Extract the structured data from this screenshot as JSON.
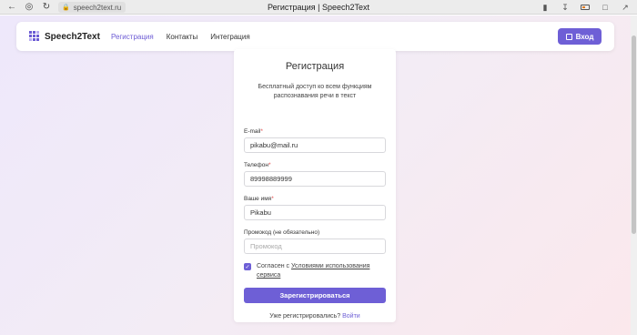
{
  "browser": {
    "address": "speech2text.ru",
    "tab_title": "Регистрация | Speech2Text"
  },
  "header": {
    "logo_text": "Speech2Text",
    "nav": [
      {
        "label": "Регистрация",
        "active": true
      },
      {
        "label": "Контакты",
        "active": false
      },
      {
        "label": "Интеграция",
        "active": false
      }
    ],
    "login_label": "Вход"
  },
  "form": {
    "title": "Регистрация",
    "subtitle": "Бесплатный доступ ко всем функциям распознавания речи в текст",
    "fields": [
      {
        "label": "E-mail",
        "required_mark": "*",
        "value": "pikabu@mail.ru",
        "placeholder": ""
      },
      {
        "label": "Телефон",
        "required_mark": "*",
        "value": "89998889999",
        "placeholder": ""
      },
      {
        "label": "Ваше имя",
        "required_mark": "*",
        "value": "Pikabu",
        "placeholder": ""
      },
      {
        "label": "Промокод (не обязательно)",
        "required_mark": "",
        "value": "",
        "placeholder": "Промокод"
      }
    ],
    "agree_prefix": "Согласен с ",
    "agree_link": "Условиями использования сервиса",
    "agree_checked": true,
    "submit_label": "Зарегистрироваться",
    "footer_prefix": "Уже регистрировались?",
    "footer_link": "Войти"
  },
  "colors": {
    "accent": "#6e5fd6"
  }
}
